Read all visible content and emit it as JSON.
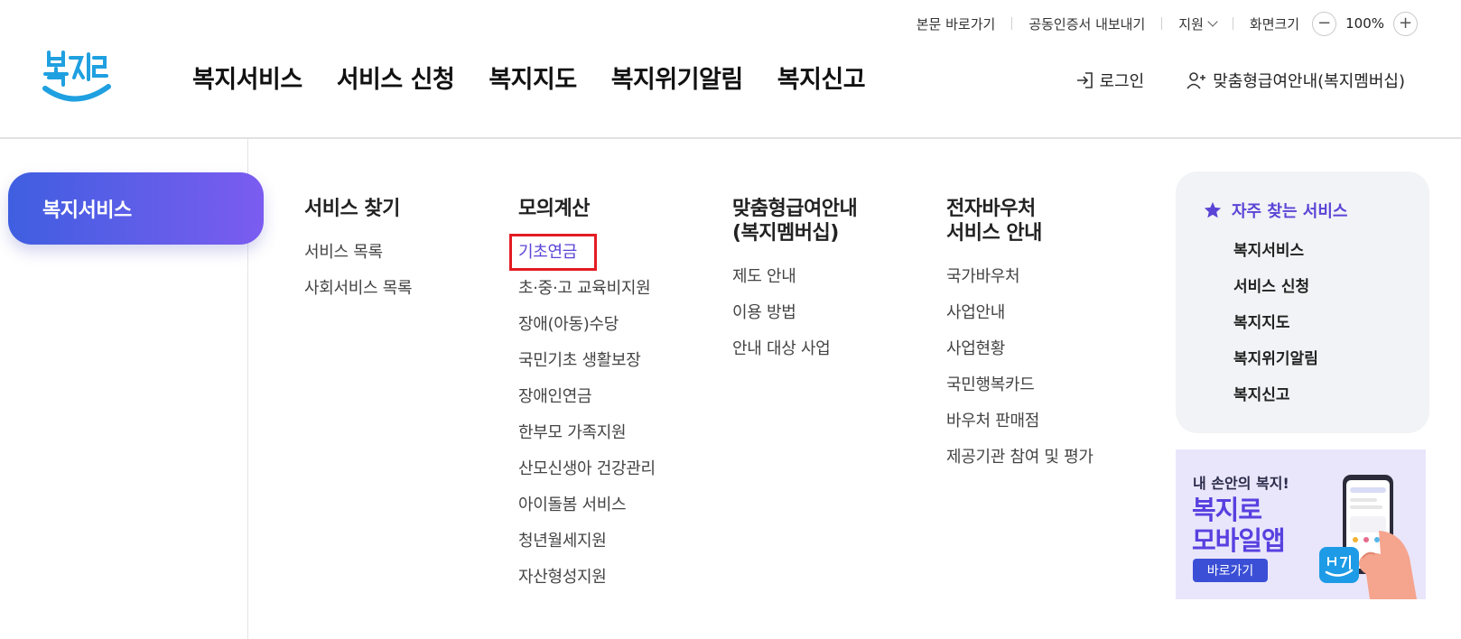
{
  "utility": {
    "skip_link": "본문 바로가기",
    "cert_export": "공동인증서 내보내기",
    "support": "지원",
    "zoom_label": "화면크기",
    "zoom_value": "100%",
    "zoom_minus": "−",
    "zoom_plus": "+"
  },
  "logo": {
    "text": "복지로"
  },
  "gnb": {
    "items": [
      "복지서비스",
      "서비스 신청",
      "복지지도",
      "복지위기알림",
      "복지신고"
    ]
  },
  "header_right": {
    "login": "로그인",
    "membership": "맞춤형급여안내(복지멤버십)"
  },
  "left_panel": {
    "selected": "복지서비스"
  },
  "menu": {
    "col1": {
      "title": "서비스 찾기",
      "items": [
        "서비스 목록",
        "사회서비스 목록"
      ]
    },
    "col2": {
      "title": "모의계산",
      "items": [
        "기초연금",
        "초·중·고 교육비지원",
        "장애(아동)수당",
        "국민기초 생활보장",
        "장애인연금",
        "한부모 가족지원",
        "산모신생아 건강관리",
        "아이돌봄 서비스",
        "청년월세지원",
        "자산형성지원"
      ]
    },
    "col3": {
      "title": "맞춤형급여안내\n(복지멤버십)",
      "items": [
        "제도 안내",
        "이용 방법",
        "안내 대상 사업"
      ]
    },
    "col4": {
      "title": "전자바우처\n서비스 안내",
      "items": [
        "국가바우처",
        "사업안내",
        "사업현황",
        "국민행복카드",
        "바우처 판매점",
        "제공기관 참여 및 평가"
      ]
    }
  },
  "favorites": {
    "title": "자주 찾는 서비스",
    "items": [
      "복지서비스",
      "서비스 신청",
      "복지지도",
      "복지위기알림",
      "복지신고"
    ]
  },
  "banner": {
    "subtitle": "내 손안의 복지!",
    "title_line1": "복지로",
    "title_line2": "모바일앱",
    "button": "바로가기"
  },
  "colors": {
    "accent": "#5a44d6",
    "pill_start": "#3f5fe0",
    "pill_end": "#7b5cf0",
    "highlight_box": "#e31c23",
    "logo_blue": "#1fa0e0"
  }
}
